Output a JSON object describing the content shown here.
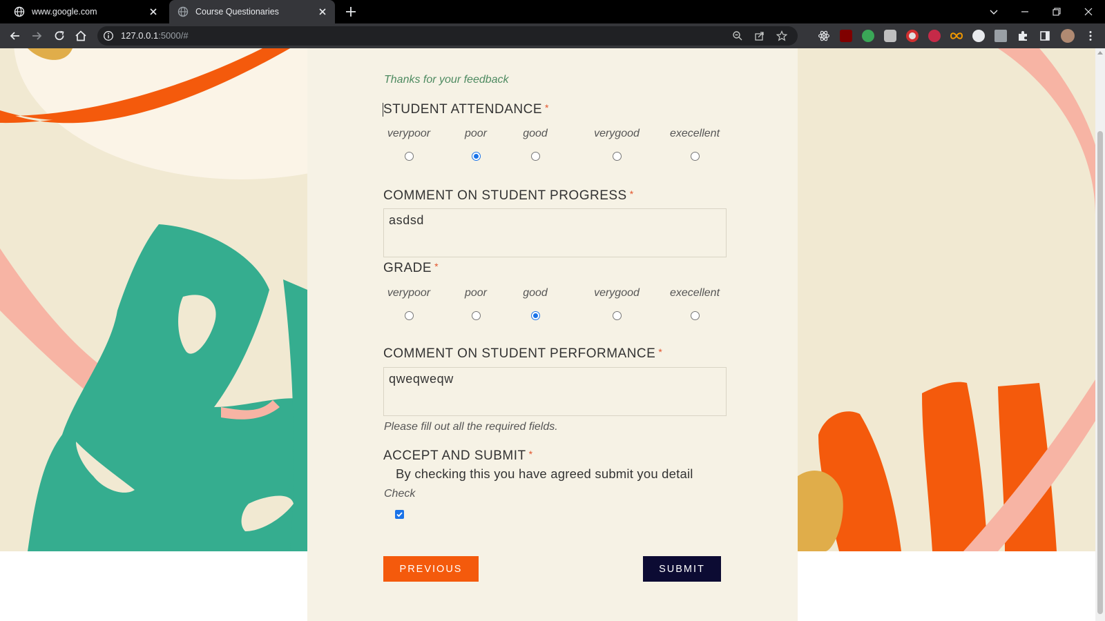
{
  "browser": {
    "tabs": [
      {
        "title": "www.google.com",
        "active": false
      },
      {
        "title": "Course Questionaries",
        "active": true
      }
    ],
    "url_host": "127.0.0.1",
    "url_rest": ":5000/#"
  },
  "form": {
    "success_message": "Thanks for your feedback",
    "required_mark": "*",
    "attendance": {
      "label": "STUDENT ATTENDANCE",
      "options": [
        "verypoor",
        "poor",
        "good",
        "verygood",
        "execellent"
      ],
      "selected": "poor"
    },
    "progress_comment": {
      "label": "COMMENT ON STUDENT PROGRESS",
      "value": "asdsd"
    },
    "grade": {
      "label": "GRADE",
      "options": [
        "verypoor",
        "poor",
        "good",
        "verygood",
        "execellent"
      ],
      "selected": "good"
    },
    "performance_comment": {
      "label": "COMMENT ON STUDENT PERFORMANCE",
      "value": "qweqweqw"
    },
    "warning": "Please fill out all the required fields.",
    "accept": {
      "label": "ACCEPT AND SUBMIT",
      "consent_text": "By checking this you have agreed submit you detail",
      "check_label": "Check",
      "checked": true
    },
    "buttons": {
      "previous": "PREVIOUS",
      "submit": "SUBMIT"
    }
  },
  "colors": {
    "accent_orange": "#f45a0c",
    "submit_navy": "#0c0b33",
    "card_bg": "#f6f2e5",
    "success_green": "#4d8a60",
    "leaf_green": "#35ad8f",
    "blush_pink": "#f7b4a4"
  }
}
